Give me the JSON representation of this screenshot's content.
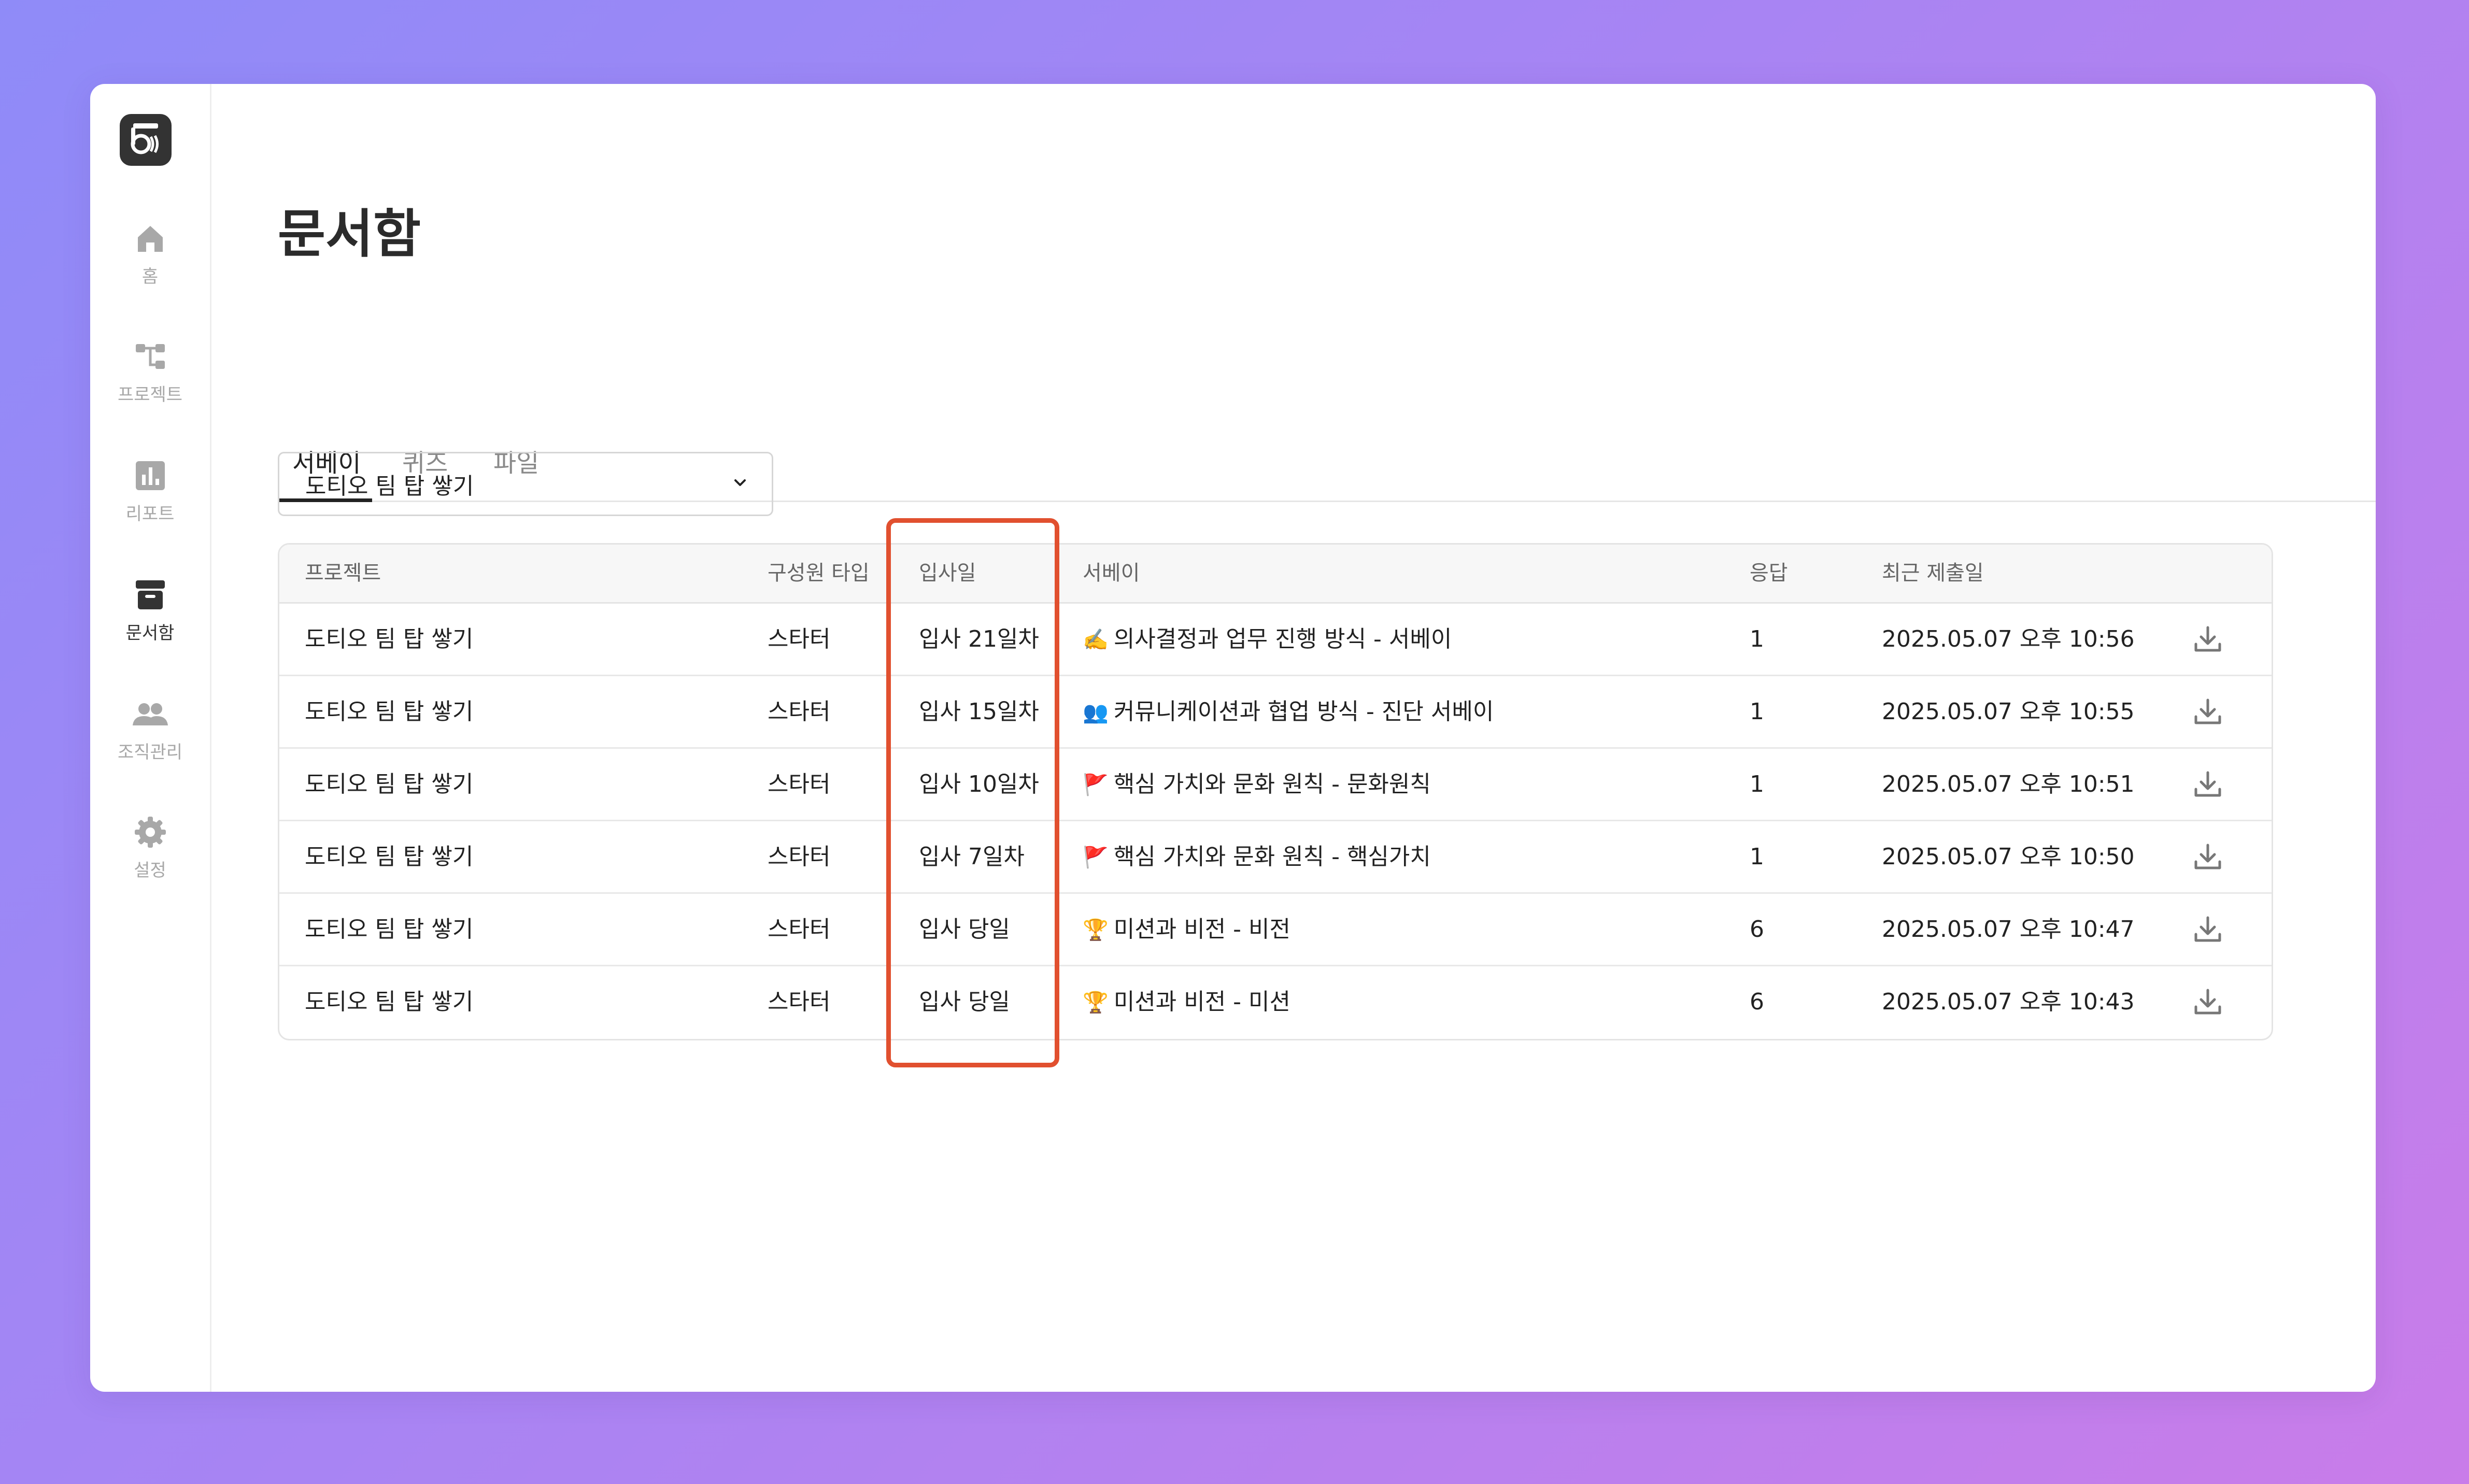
{
  "sidebar": {
    "logo": {
      "icon": "app-logo-icon"
    },
    "items": [
      {
        "label": "홈",
        "icon": "home-icon"
      },
      {
        "label": "프로젝트",
        "icon": "project-tree-icon"
      },
      {
        "label": "리포트",
        "icon": "bar-chart-icon"
      },
      {
        "label": "문서함",
        "icon": "archive-box-icon",
        "active": true
      },
      {
        "label": "조직관리",
        "icon": "users-icon"
      },
      {
        "label": "설정",
        "icon": "gear-icon"
      }
    ]
  },
  "page": {
    "title": "문서함"
  },
  "tabs": [
    {
      "label": "서베이",
      "active": true
    },
    {
      "label": "퀴즈"
    },
    {
      "label": "파일"
    }
  ],
  "filter": {
    "selected": "도티오 팀 탑 쌓기",
    "icon": "chevron-down-icon"
  },
  "table": {
    "columns": [
      "프로젝트",
      "구성원 타입",
      "입사일",
      "서베이",
      "응답",
      "최근 제출일"
    ],
    "rows": [
      {
        "project": "도티오 팀 탑 쌓기",
        "member_type": "스타터",
        "join_day": "입사 21일차",
        "survey_emoji": "✍️",
        "survey": "의사결정과 업무 진행 방식 - 서베이",
        "responses": "1",
        "submitted": "2025.05.07 오후 10:56"
      },
      {
        "project": "도티오 팀 탑 쌓기",
        "member_type": "스타터",
        "join_day": "입사 15일차",
        "survey_emoji": "👥",
        "survey": "커뮤니케이션과 협업 방식 - 진단 서베이",
        "responses": "1",
        "submitted": "2025.05.07 오후 10:55"
      },
      {
        "project": "도티오 팀 탑 쌓기",
        "member_type": "스타터",
        "join_day": "입사 10일차",
        "survey_emoji": "🚩",
        "survey": "핵심 가치와 문화 원칙 - 문화원칙",
        "responses": "1",
        "submitted": "2025.05.07 오후 10:51"
      },
      {
        "project": "도티오 팀 탑 쌓기",
        "member_type": "스타터",
        "join_day": "입사 7일차",
        "survey_emoji": "🚩",
        "survey": "핵심 가치와 문화 원칙 - 핵심가치",
        "responses": "1",
        "submitted": "2025.05.07 오후 10:50"
      },
      {
        "project": "도티오 팀 탑 쌓기",
        "member_type": "스타터",
        "join_day": "입사 당일",
        "survey_emoji": "🏆",
        "survey": "미션과 비전 - 비전",
        "responses": "6",
        "submitted": "2025.05.07 오후 10:47"
      },
      {
        "project": "도티오 팀 탑 쌓기",
        "member_type": "스타터",
        "join_day": "입사 당일",
        "survey_emoji": "🏆",
        "survey": "미션과 비전 - 미션",
        "responses": "6",
        "submitted": "2025.05.07 오후 10:43"
      }
    ],
    "row_action_icon": "download-icon"
  },
  "colors": {
    "highlight": "#e1502f",
    "active_icon": "#333333",
    "inactive_icon": "#a8a8a8"
  }
}
